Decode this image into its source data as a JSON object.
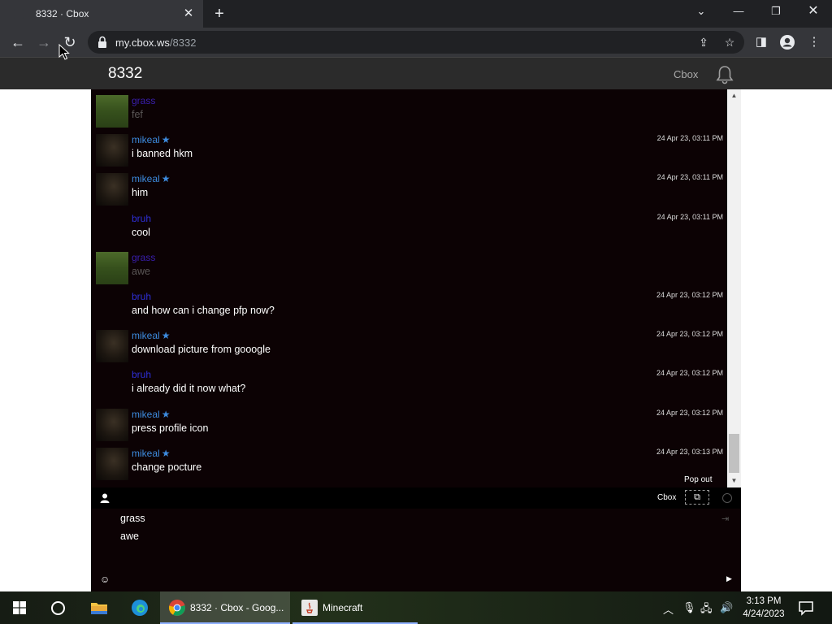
{
  "browser": {
    "tab_title": "8332 · Cbox",
    "tab_close": "✕",
    "new_tab": "+",
    "url_host": "my.cbox.ws",
    "url_path": "/8332"
  },
  "header": {
    "title": "8332",
    "brand_link": "Cbox"
  },
  "messages": [
    {
      "author": "grass",
      "author_color": "#3a1fb0",
      "avatar": "grass",
      "text": "fef",
      "text_color": "#5a5656",
      "time": "",
      "starred": false
    },
    {
      "author": "mikeal",
      "author_color": "#3d8bde",
      "avatar": "dark",
      "text": "i banned hkm",
      "text_color": "#ffffff",
      "time": "24 Apr 23, 03:11 PM",
      "starred": true
    },
    {
      "author": "mikeal",
      "author_color": "#3d8bde",
      "avatar": "dark",
      "text": "him",
      "text_color": "#ffffff",
      "time": "24 Apr 23, 03:11 PM",
      "starred": true
    },
    {
      "author": "bruh",
      "author_color": "#2e2fd6",
      "avatar": "none",
      "text": "cool",
      "text_color": "#ffffff",
      "time": "24 Apr 23, 03:11 PM",
      "starred": false
    },
    {
      "author": "grass",
      "author_color": "#3a1fb0",
      "avatar": "grass",
      "text": "awe",
      "text_color": "#5a5656",
      "time": "",
      "starred": false
    },
    {
      "author": "bruh",
      "author_color": "#2e2fd6",
      "avatar": "none",
      "text": "and how can i change pfp now?",
      "text_color": "#ffffff",
      "time": "24 Apr 23, 03:12 PM",
      "starred": false
    },
    {
      "author": "mikeal",
      "author_color": "#3d8bde",
      "avatar": "dark",
      "text": "download picture from gooogle",
      "text_color": "#ffffff",
      "time": "24 Apr 23, 03:12 PM",
      "starred": true
    },
    {
      "author": "bruh",
      "author_color": "#2e2fd6",
      "avatar": "none",
      "text": "i already did it now what?",
      "text_color": "#ffffff",
      "time": "24 Apr 23, 03:12 PM",
      "starred": false
    },
    {
      "author": "mikeal",
      "author_color": "#3d8bde",
      "avatar": "dark",
      "text": "press profile icon",
      "text_color": "#ffffff",
      "time": "24 Apr 23, 03:12 PM",
      "starred": true
    },
    {
      "author": "mikeal",
      "author_color": "#3d8bde",
      "avatar": "dark",
      "text": "change pocture",
      "text_color": "#ffffff",
      "time": "24 Apr 23, 03:13 PM",
      "starred": true
    }
  ],
  "chat_footer": {
    "popout_label": "Pop out",
    "brand": "Cbox"
  },
  "users": [
    "grass",
    "awe"
  ],
  "taskbar": {
    "apps": [
      {
        "label": "8332 · Cbox - Goog...",
        "icon": "chrome-icon",
        "active": true
      },
      {
        "label": "Minecraft",
        "icon": "minecraft-icon",
        "active": false
      }
    ],
    "time": "3:13 PM",
    "date": "4/24/2023"
  },
  "colors": {
    "chat_background": "#0c0204",
    "mikeal": "#3d8bde",
    "bruh": "#2e2fd6",
    "grass": "#3a1fb0"
  }
}
